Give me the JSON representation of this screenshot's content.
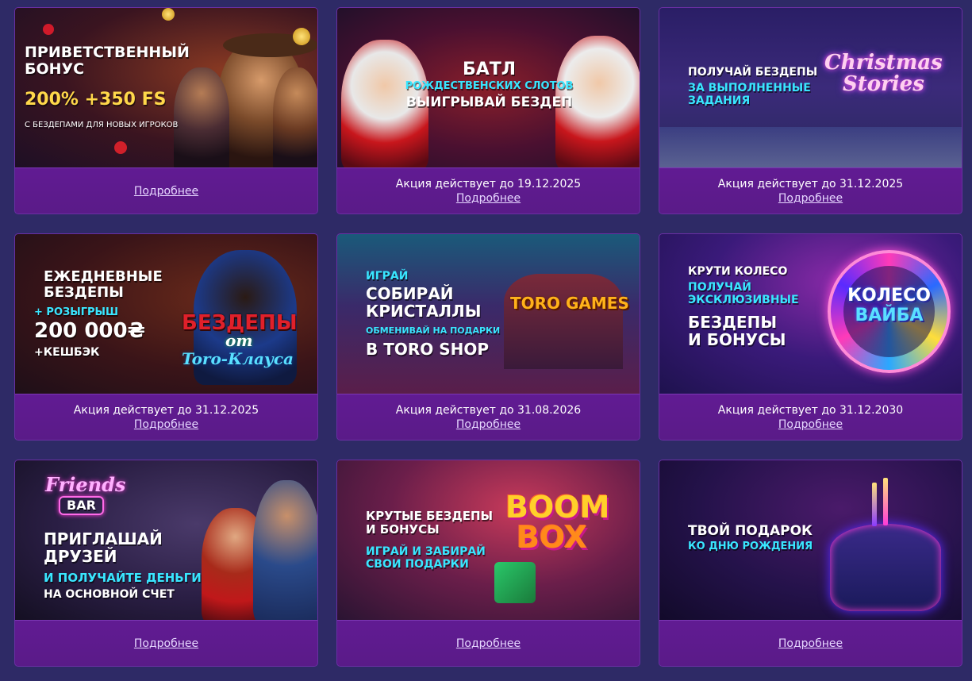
{
  "promos": [
    {
      "lines": [
        "ПРИВЕТСТВЕННЫЙ",
        "БОНУС",
        "200% +350 FS",
        "С БЕЗДЕПАМИ ДЛЯ НОВЫХ ИГРОКОВ"
      ],
      "validity": "",
      "more": "Подробнее"
    },
    {
      "lines": [
        "БАТЛ",
        "РОЖДЕСТВЕНСКИХ СЛОТОВ",
        "ВЫИГРЫВАЙ БЕЗДЕП"
      ],
      "validity": "Акция действует до 19.12.2025",
      "more": "Подробнее"
    },
    {
      "lines": [
        "ПОЛУЧАЙ БЕЗДЕПЫ",
        "ЗА ВЫПОЛНЕННЫЕ",
        "ЗАДАНИЯ"
      ],
      "logo": [
        "Christmas",
        "Stories"
      ],
      "validity": "Акция действует до 31.12.2025",
      "more": "Подробнее"
    },
    {
      "lines": [
        "ЕЖЕДНЕВНЫЕ",
        "БЕЗДЕПЫ",
        "+ РОЗЫГРЫШ",
        "200 000₴",
        "+КЕШБЭК"
      ],
      "logo": [
        "БЕЗДЕПЫ",
        "от",
        "Toro-Клауса"
      ],
      "validity": "Акция действует до 31.12.2025",
      "more": "Подробнее"
    },
    {
      "lines": [
        "ИГРАЙ",
        "СОБИРАЙ",
        "КРИСТАЛЛЫ",
        "ОБМЕНИВАЙ НА ПОДАРКИ",
        "В TORO SHOP"
      ],
      "logo": [
        "TORO GAMES"
      ],
      "validity": "Акция действует до 31.08.2026",
      "more": "Подробнее"
    },
    {
      "lines": [
        "КРУТИ КОЛЕСО",
        "ПОЛУЧАЙ",
        "ЭКСКЛЮЗИВНЫЕ",
        "БЕЗДЕПЫ",
        "И БОНУСЫ"
      ],
      "logo": [
        "КОЛЕСО",
        "ВАЙБА"
      ],
      "validity": "Акция действует до 31.12.2030",
      "more": "Подробнее"
    },
    {
      "lines": [
        "ПРИГЛАШАЙ",
        "ДРУЗЕЙ",
        "И ПОЛУЧАЙТЕ ДЕНЬГИ",
        "НА ОСНОВНОЙ СЧЕТ"
      ],
      "logo": [
        "Friends",
        "BAR"
      ],
      "validity": "",
      "more": "Подробнее"
    },
    {
      "lines": [
        "КРУТЫЕ БЕЗДЕПЫ",
        "И БОНУСЫ",
        "ИГРАЙ И ЗАБИРАЙ",
        "СВОИ ПОДАРКИ"
      ],
      "logo": [
        "BOOM",
        "BOX"
      ],
      "validity": "",
      "more": "Подробнее"
    },
    {
      "lines": [
        "ТВОЙ ПОДАРОК",
        "КО ДНЮ РОЖДЕНИЯ"
      ],
      "validity": "",
      "more": "Подробнее"
    }
  ]
}
